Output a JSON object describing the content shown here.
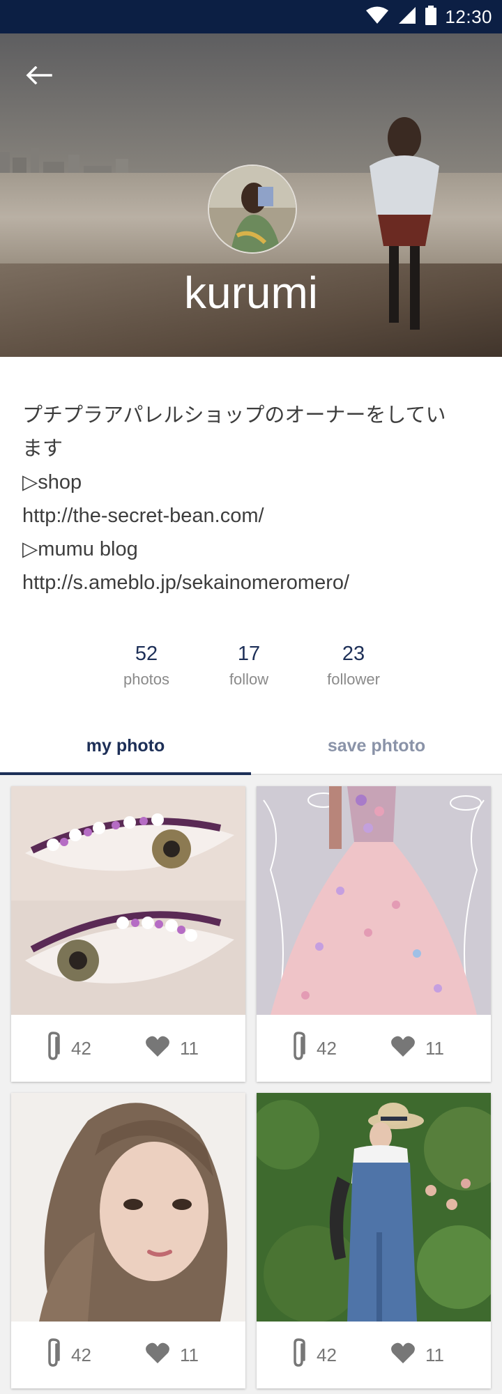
{
  "status_bar": {
    "time": "12:30",
    "icons": [
      "wifi-icon",
      "signal-icon",
      "battery-icon"
    ]
  },
  "header": {
    "back_icon": "arrow-left-icon",
    "username": "kurumi"
  },
  "bio": {
    "lines": [
      "プチプラアパレルショップのオーナーをしてい",
      "ます",
      "▷shop",
      "http://the-secret-bean.com/",
      "▷mumu blog",
      "http://s.ameblo.jp/sekainomeromero/"
    ]
  },
  "stats": [
    {
      "value": "52",
      "label": "photos"
    },
    {
      "value": "17",
      "label": "follow"
    },
    {
      "value": "23",
      "label": "follower"
    }
  ],
  "tabs": [
    {
      "label": "my photo",
      "active": true
    },
    {
      "label": "save phtoto",
      "active": false
    }
  ],
  "photos": [
    {
      "subject": "flower eyelashes",
      "clips": "42",
      "likes": "11"
    },
    {
      "subject": "pink floral gown",
      "clips": "42",
      "likes": "11"
    },
    {
      "subject": "portrait",
      "clips": "42",
      "likes": "11"
    },
    {
      "subject": "denim overalls",
      "clips": "42",
      "likes": "11"
    }
  ],
  "colors": {
    "status_bar": "#0c1f44",
    "accent": "#1d2f57",
    "inactive_tab": "#8a93a8",
    "grid_background": "#f1f1f1"
  }
}
